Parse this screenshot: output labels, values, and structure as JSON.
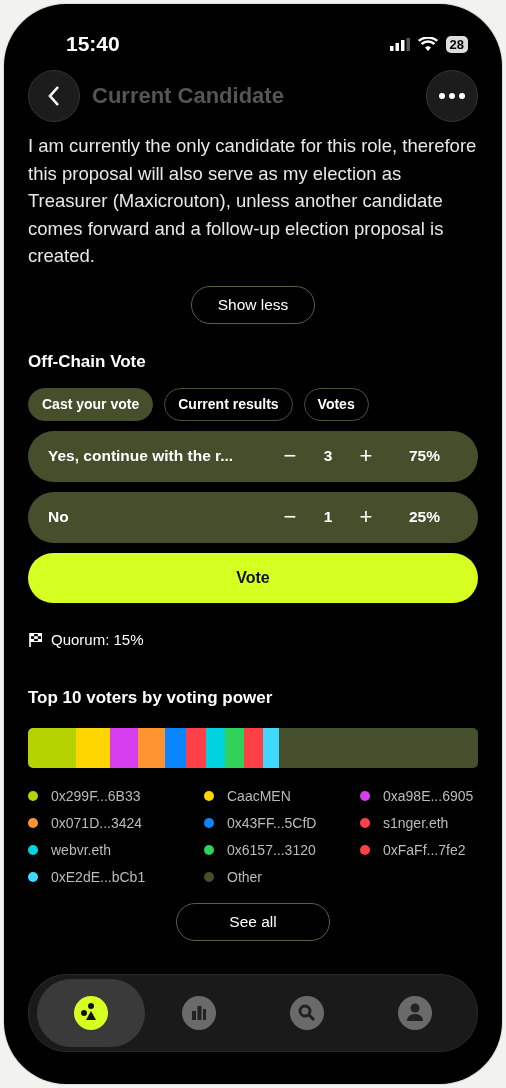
{
  "status_bar": {
    "time": "15:40",
    "battery": "28"
  },
  "header": {
    "title": "Current Candidate"
  },
  "description": "I am currently the only candidate for this role, therefore this proposal will also serve as my election as Treasurer (Maxicrouton), unless another candidate comes forward and a follow-up election proposal is created.",
  "show_less": "Show less",
  "vote_section": {
    "title": "Off-Chain Vote",
    "tabs": [
      {
        "label": "Cast your vote",
        "selected": true
      },
      {
        "label": "Current results",
        "selected": false
      },
      {
        "label": "Votes",
        "selected": false
      }
    ],
    "options": [
      {
        "label": "Yes, continue with the r...",
        "minus": "−",
        "count": "3",
        "plus": "+",
        "percent": "75%"
      },
      {
        "label": "No",
        "minus": "−",
        "count": "1",
        "plus": "+",
        "percent": "25%"
      }
    ],
    "vote_button": "Vote",
    "quorum": "Quorum: 15%"
  },
  "top_voters": {
    "title": "Top 10 voters by voting power",
    "voters": [
      {
        "name": "0x299F...6B33",
        "color": "#b5d300"
      },
      {
        "name": "CaacMEN",
        "color": "#ffd600"
      },
      {
        "name": "0xa98E...6905",
        "color": "#d63ef0"
      },
      {
        "name": "0x071D...3424",
        "color": "#ff9330"
      },
      {
        "name": "0x43FF...5CfD",
        "color": "#0a84ff"
      },
      {
        "name": "s1nger.eth",
        "color": "#ff4048"
      },
      {
        "name": "webvr.eth",
        "color": "#00d3e0"
      },
      {
        "name": "0x6157...3120",
        "color": "#30d158"
      },
      {
        "name": "0xFaFf...7fe2",
        "color": "#ff4045"
      },
      {
        "name": "0xE2dE...bCb1",
        "color": "#40d8ff"
      },
      {
        "name": "Other",
        "color": "#454f2c"
      }
    ],
    "see_all": "See all"
  },
  "bottom_nav": [
    {
      "kind": "logo",
      "selected": true
    },
    {
      "kind": "chart",
      "selected": false
    },
    {
      "kind": "search",
      "selected": false
    },
    {
      "kind": "profile",
      "selected": false
    }
  ]
}
